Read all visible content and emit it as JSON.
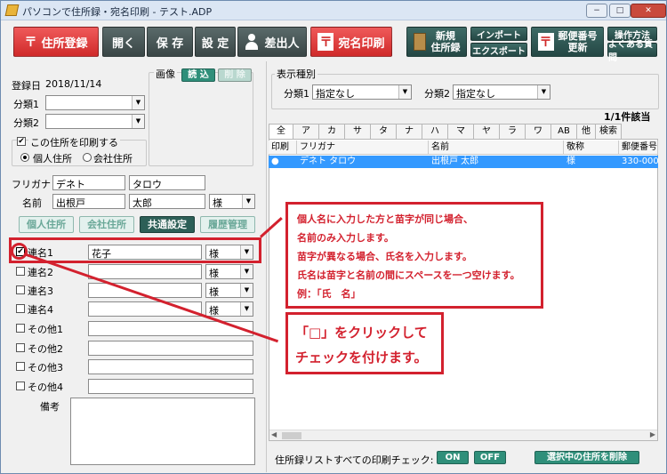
{
  "window": {
    "title": "パソコンで住所録・宛名印刷 - テスト.ADP",
    "min": "−",
    "max": "□",
    "close": "✕"
  },
  "toolbar": {
    "register": "住所登録",
    "register_icon": "〒",
    "open": "開く",
    "save": "保 存",
    "settings": "設 定",
    "sender": "差出人",
    "print": "宛名印刷",
    "print_icon": "〒",
    "new_book": [
      "新規",
      "住所録"
    ],
    "import": "インポート",
    "export": "エクスポート",
    "postal_update": [
      "郵便番号",
      "更新"
    ],
    "postal_icon": "〒",
    "howto": "操作方法",
    "faq": "よくある質問"
  },
  "form": {
    "reg_date_label": "登録日",
    "reg_date": "2018/11/14",
    "cat1_label": "分類1",
    "cat1_value": "",
    "cat2_label": "分類2",
    "cat2_value": "",
    "image_label": "画像",
    "image_load": "読 込",
    "image_delete": "削 除",
    "print_check_label": "この住所を印刷する",
    "personal_addr": "個人住所",
    "company_addr": "会社住所",
    "furigana_label": "フリガナ",
    "furigana_last": "デネト",
    "furigana_first": "タロウ",
    "name_label": "名前",
    "name_last": "出根戸",
    "name_first": "太郎",
    "honorific": "様",
    "tabs": [
      "個人住所",
      "会社住所",
      "共通設定",
      "履歴管理"
    ],
    "joint": [
      {
        "label": "連名1",
        "value": "花子",
        "honorific": "様",
        "checked": "✔"
      },
      {
        "label": "連名2",
        "value": "",
        "honorific": "様",
        "checked": ""
      },
      {
        "label": "連名3",
        "value": "",
        "honorific": "様",
        "checked": ""
      },
      {
        "label": "連名4",
        "value": "",
        "honorific": "様",
        "checked": ""
      }
    ],
    "others": [
      "その他1",
      "その他2",
      "その他3",
      "その他4"
    ],
    "note_label": "備考"
  },
  "right": {
    "display_type": "表示種別",
    "cat1_label": "分類1",
    "cat1_value": "指定なし",
    "cat2_label": "分類2",
    "cat2_value": "指定なし",
    "count": "1/1件該当",
    "index_tabs": [
      "全",
      "ア",
      "カ",
      "サ",
      "タ",
      "ナ",
      "ハ",
      "マ",
      "ヤ",
      "ラ",
      "ワ",
      "AB",
      "他",
      "検索"
    ],
    "columns": [
      "印刷",
      "フリガナ",
      "名前",
      "敬称",
      "郵便番号"
    ],
    "rows": [
      {
        "print": "●",
        "furigana": "デネト タロウ",
        "name": "出根戸 太郎",
        "honorific": "様",
        "postal": "330-000"
      }
    ],
    "bottom_label": "住所録リストすべての印刷チェック:",
    "on": "ON",
    "off": "OFF",
    "delete_selected": "選択中の住所を削除"
  },
  "annotations": {
    "note_lines": [
      "個人名に入力した方と苗字が同じ場合、",
      "名前のみ入力します。",
      "苗字が異なる場合、氏名を入力します。",
      "氏名は苗字と名前の間にスペースを一つ空けます。",
      "例：「氏　名」"
    ],
    "click_lines": [
      "「□」をクリックして",
      "チェックを付けます。"
    ]
  }
}
